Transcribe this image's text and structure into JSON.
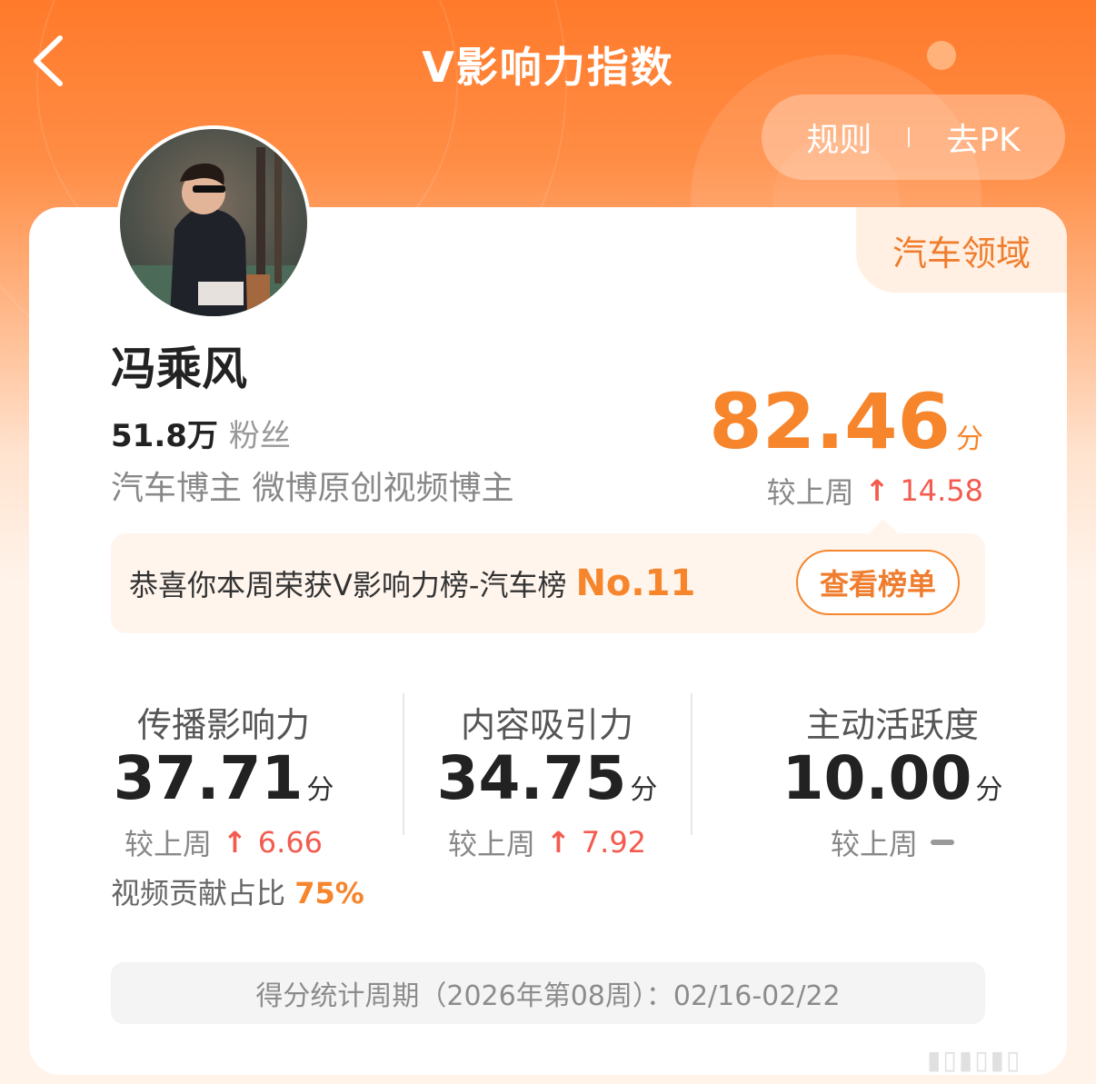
{
  "header": {
    "title": "V影响力指数",
    "rules_label": "规则",
    "separator": "I",
    "pk_label": "去PK"
  },
  "card": {
    "domain_tag": "汽车领域",
    "user_name": "冯乘风",
    "fans_count": "51.8万",
    "fans_label": "粉丝",
    "tags": "汽车博主 微博原创视频博主",
    "total_score": "82.46",
    "score_unit": "分",
    "week_compare_label": "较上周",
    "total_change": "14.58",
    "banner_text": "恭喜你本周荣获V影响力榜-汽车榜",
    "banner_rank": "No.11",
    "rank_button": "查看榜单",
    "metrics": [
      {
        "name": "传播影响力",
        "score": "37.71",
        "unit": "分",
        "change_label": "较上周",
        "change": "6.66"
      },
      {
        "name": "内容吸引力",
        "score": "34.75",
        "unit": "分",
        "change_label": "较上周",
        "change": "7.92"
      },
      {
        "name": "主动活跃度",
        "score": "10.00",
        "unit": "分",
        "change_label": "较上周",
        "change": ""
      }
    ],
    "video_ratio_label": "视频贡献占比",
    "video_ratio_value": "75%",
    "period_text": "得分统计周期（2026年第08周）：02/16-02/22"
  },
  "colors": {
    "accent": "#f6852c",
    "up": "#f35b4f",
    "header_top": "#ff7a2b"
  },
  "icons": [
    "back-chevron-icon",
    "up-arrow-icon",
    "no-change-dash-icon"
  ]
}
